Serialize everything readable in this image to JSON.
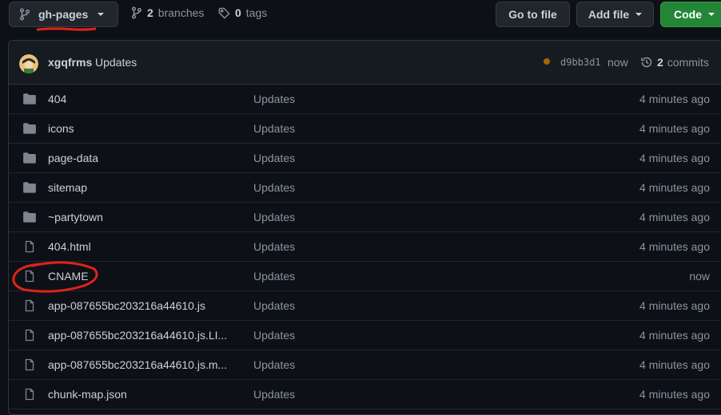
{
  "toolbar": {
    "branch_name": "gh-pages",
    "branches_count": "2",
    "branches_label": "branches",
    "tags_count": "0",
    "tags_label": "tags",
    "go_to_file": "Go to file",
    "add_file": "Add file",
    "code": "Code"
  },
  "commit": {
    "author": "xgqfrms",
    "message": "Updates",
    "sha": "d9bb3d1",
    "time": "now",
    "commits_count": "2",
    "commits_label": "commits",
    "status_color": "#9e6a03"
  },
  "files": [
    {
      "type": "folder",
      "name": "404",
      "message": "Updates",
      "age": "4 minutes ago"
    },
    {
      "type": "folder",
      "name": "icons",
      "message": "Updates",
      "age": "4 minutes ago"
    },
    {
      "type": "folder",
      "name": "page-data",
      "message": "Updates",
      "age": "4 minutes ago"
    },
    {
      "type": "folder",
      "name": "sitemap",
      "message": "Updates",
      "age": "4 minutes ago"
    },
    {
      "type": "folder",
      "name": "~partytown",
      "message": "Updates",
      "age": "4 minutes ago"
    },
    {
      "type": "file",
      "name": "404.html",
      "message": "Updates",
      "age": "4 minutes ago"
    },
    {
      "type": "file",
      "name": "CNAME",
      "message": "Updates",
      "age": "now"
    },
    {
      "type": "file",
      "name": "app-087655bc203216a44610.js",
      "message": "Updates",
      "age": "4 minutes ago"
    },
    {
      "type": "file",
      "name": "app-087655bc203216a44610.js.LI...",
      "message": "Updates",
      "age": "4 minutes ago"
    },
    {
      "type": "file",
      "name": "app-087655bc203216a44610.js.m...",
      "message": "Updates",
      "age": "4 minutes ago"
    },
    {
      "type": "file",
      "name": "chunk-map.json",
      "message": "Updates",
      "age": "4 minutes ago"
    }
  ],
  "annotation_color": "#e0231b"
}
